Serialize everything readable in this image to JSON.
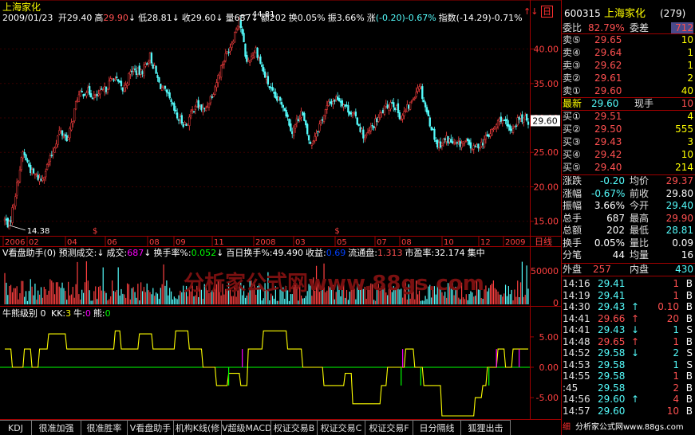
{
  "app": {
    "stock_name": "上海家化",
    "watermark": "分析家公式网www.88gs.com",
    "window_icons": [
      "↑↓",
      "日"
    ]
  },
  "colors": {
    "up": "#ff4040",
    "down": "#54fcfc",
    "yellow": "#ffff00",
    "grid": "#a00000",
    "green": "#00ff00",
    "magenta": "#ff00ff",
    "label": "#ffffff"
  },
  "header": {
    "date": "2009/01/23",
    "items": [
      {
        "label": "开",
        "value": "29.40",
        "color": "#ffffff"
      },
      {
        "label": "高",
        "value": "29.90",
        "color": "#ff5050"
      },
      {
        "label": "低",
        "value": "28.81",
        "color": "#ffffff",
        "arrow": "↓"
      },
      {
        "label": "收",
        "value": "29.60",
        "color": "#ffffff",
        "arrow": "↓"
      },
      {
        "label": "量",
        "value": "687",
        "color": "#ffffff",
        "arrow": "↓"
      },
      {
        "label": "额",
        "value": "202",
        "color": "#ffffff",
        "arrow": "↓"
      },
      {
        "label": "换",
        "value": "0.05%",
        "color": "#ffffff"
      },
      {
        "label": "振",
        "value": "3.66%",
        "color": "#ffffff"
      },
      {
        "label": "涨",
        "value": "(-0.20)-0.67%",
        "color": "#54fcfc"
      },
      {
        "label": "指数",
        "value": "(-14.29)-0.71%",
        "color": "#ffffff"
      }
    ]
  },
  "volume_header": {
    "title": "V看盘助手(0) 预测成交:",
    "items": [
      {
        "label": "成交:",
        "value": "687",
        "color": "#ff00ff",
        "arrow": "↓"
      },
      {
        "label": "换手率%:",
        "value": "0.052",
        "color": "#00ff00",
        "arrow": "↓"
      },
      {
        "label": "百日换手%:",
        "value": "49.490",
        "color": "#ffffff",
        "arrow": "↓"
      },
      {
        "label": "收益:",
        "value": "0.69",
        "color": "#0040ff"
      },
      {
        "label": "流通盘:",
        "value": "1.313",
        "color": "#ff5050"
      },
      {
        "label": "市盈率:",
        "value": "32.174",
        "color": "#ffffff"
      },
      {
        "label": "集中",
        "value": "",
        "color": "#ff0000"
      }
    ]
  },
  "indicator_header": {
    "title": "牛熊级别 0",
    "items": [
      {
        "label": "KK:",
        "value": "3",
        "color": "#ffff00"
      },
      {
        "label": "牛:",
        "value": "0",
        "color": "#ff00ff"
      },
      {
        "label": "熊:",
        "value": "0",
        "color": "#00ff00"
      }
    ]
  },
  "chart_data": {
    "type": "candlestick",
    "price_axis": {
      "ticks": [
        "40.00",
        "35.00",
        "30.00",
        "25.00",
        "20.00",
        "15.00"
      ],
      "range": [
        13.0,
        45.5
      ]
    },
    "current_price_tag": "29.60",
    "annotations": {
      "max": "44.81",
      "min": "14.38"
    },
    "x_labels": [
      "2006",
      "02",
      "04",
      "06",
      "08",
      "09",
      "11",
      "2008",
      "03",
      "05",
      "07",
      "08",
      "10",
      "12",
      "2009"
    ],
    "period_label": "日线",
    "volume_axis": {
      "ticks": [
        "50000",
        "0"
      ]
    },
    "indicator_axis": {
      "ticks": [
        "5.00",
        "0.00",
        "-5.00"
      ],
      "range": [
        -8,
        8
      ]
    },
    "price_anchors": [
      [
        0,
        15.2
      ],
      [
        3,
        14.4
      ],
      [
        7,
        19
      ],
      [
        12,
        25
      ],
      [
        18,
        22
      ],
      [
        24,
        21
      ],
      [
        30,
        24
      ],
      [
        36,
        28
      ],
      [
        42,
        27
      ],
      [
        48,
        33
      ],
      [
        54,
        34
      ],
      [
        60,
        33
      ],
      [
        66,
        34
      ],
      [
        72,
        36
      ],
      [
        78,
        34
      ],
      [
        84,
        37
      ],
      [
        90,
        36.5
      ],
      [
        96,
        39
      ],
      [
        102,
        35
      ],
      [
        108,
        33
      ],
      [
        114,
        30
      ],
      [
        120,
        29
      ],
      [
        126,
        32
      ],
      [
        132,
        31
      ],
      [
        138,
        34
      ],
      [
        144,
        38
      ],
      [
        150,
        41
      ],
      [
        155,
        44.5
      ],
      [
        160,
        38
      ],
      [
        166,
        40
      ],
      [
        172,
        36
      ],
      [
        178,
        33
      ],
      [
        184,
        32
      ],
      [
        190,
        28
      ],
      [
        196,
        31
      ],
      [
        202,
        26
      ],
      [
        208,
        29
      ],
      [
        214,
        32
      ],
      [
        220,
        33
      ],
      [
        226,
        31.5
      ],
      [
        232,
        30
      ],
      [
        238,
        27
      ],
      [
        244,
        29
      ],
      [
        250,
        31
      ],
      [
        256,
        32.5
      ],
      [
        262,
        30
      ],
      [
        268,
        32
      ],
      [
        274,
        35
      ],
      [
        280,
        30
      ],
      [
        286,
        26
      ],
      [
        292,
        27
      ],
      [
        298,
        26
      ],
      [
        304,
        26.5
      ],
      [
        310,
        25.5
      ],
      [
        316,
        26.5
      ],
      [
        322,
        28
      ],
      [
        328,
        30
      ],
      [
        334,
        28
      ],
      [
        340,
        30
      ],
      [
        346,
        29.6
      ]
    ],
    "indicator_kk": [
      [
        0,
        3
      ],
      [
        4,
        3
      ],
      [
        5,
        0
      ],
      [
        12,
        0
      ],
      [
        13,
        3
      ],
      [
        17,
        3
      ],
      [
        18,
        0
      ],
      [
        22,
        0
      ],
      [
        23,
        3
      ],
      [
        28,
        3
      ],
      [
        29,
        5.5
      ],
      [
        40,
        5.5
      ],
      [
        41,
        3
      ],
      [
        72,
        3
      ],
      [
        73,
        6
      ],
      [
        76,
        6
      ],
      [
        77,
        3
      ],
      [
        88,
        3
      ],
      [
        89,
        5.5
      ],
      [
        97,
        5.5
      ],
      [
        98,
        3
      ],
      [
        112,
        3
      ],
      [
        113,
        6
      ],
      [
        121,
        6
      ],
      [
        122,
        3
      ],
      [
        130,
        3
      ],
      [
        131,
        0
      ],
      [
        139,
        0
      ],
      [
        140,
        -3
      ],
      [
        147,
        -3
      ],
      [
        148,
        -1
      ],
      [
        155,
        -1
      ],
      [
        156,
        -3
      ],
      [
        160,
        -3
      ],
      [
        161,
        3
      ],
      [
        170,
        3
      ],
      [
        171,
        6
      ],
      [
        186,
        6
      ],
      [
        187,
        3
      ],
      [
        196,
        3
      ],
      [
        197,
        0
      ],
      [
        210,
        0
      ],
      [
        211,
        -3
      ],
      [
        224,
        -3
      ],
      [
        225,
        -1
      ],
      [
        229,
        -1
      ],
      [
        230,
        -6
      ],
      [
        248,
        -6
      ],
      [
        249,
        -3
      ],
      [
        252,
        -3
      ],
      [
        253,
        0
      ],
      [
        264,
        0
      ],
      [
        265,
        3
      ],
      [
        270,
        3
      ],
      [
        271,
        0
      ],
      [
        276,
        0
      ],
      [
        277,
        -3
      ],
      [
        288,
        -3
      ],
      [
        289,
        -8
      ],
      [
        310,
        -8
      ],
      [
        311,
        -5
      ],
      [
        315,
        -5
      ],
      [
        316,
        -3
      ],
      [
        318,
        -3
      ],
      [
        319,
        0
      ],
      [
        325,
        0
      ],
      [
        326,
        3
      ],
      [
        330,
        3
      ],
      [
        331,
        0
      ],
      [
        335,
        0
      ],
      [
        336,
        3
      ],
      [
        346,
        3
      ]
    ],
    "magenta_spikes": [
      [
        157,
        0,
        3
      ],
      [
        263,
        0,
        3
      ],
      [
        325,
        0,
        3
      ],
      [
        340,
        0,
        3
      ]
    ],
    "green_spikes": [
      [
        148,
        0,
        -3
      ],
      [
        262,
        0,
        -3
      ],
      [
        275,
        0,
        -3
      ],
      [
        320,
        0,
        -3
      ]
    ]
  },
  "sidebar": {
    "code": "600315",
    "name": "上海家化",
    "code_suffix": "(279)",
    "weibi": {
      "label": "委比",
      "value": "82.79%",
      "label2": "委差",
      "value2": "712"
    },
    "sells": [
      {
        "label": "卖⑤",
        "price": "29.65",
        "vol": "10"
      },
      {
        "label": "卖④",
        "price": "29.64",
        "vol": "1"
      },
      {
        "label": "卖③",
        "price": "29.62",
        "vol": "1"
      },
      {
        "label": "卖②",
        "price": "29.61",
        "vol": "2"
      },
      {
        "label": "卖①",
        "price": "29.60",
        "vol": "40"
      }
    ],
    "latest": {
      "label": "最新",
      "value": "29.60",
      "label2": "现手",
      "value2": "10"
    },
    "buys": [
      {
        "label": "买①",
        "price": "29.51",
        "vol": "4"
      },
      {
        "label": "买②",
        "price": "29.50",
        "vol": "555"
      },
      {
        "label": "买③",
        "price": "29.43",
        "vol": "3"
      },
      {
        "label": "买④",
        "price": "29.42",
        "vol": "10"
      },
      {
        "label": "买⑤",
        "price": "29.40",
        "vol": "214"
      }
    ],
    "stats": [
      {
        "l1": "涨跌",
        "v1": "-0.20",
        "c1": "#54fcfc",
        "l2": "均价",
        "v2": "29.37",
        "c2": "#ff5050"
      },
      {
        "l1": "涨幅",
        "v1": "-0.67%",
        "c1": "#54fcfc",
        "l2": "前收",
        "v2": "29.80",
        "c2": "#ffffff"
      },
      {
        "l1": "振幅",
        "v1": "3.66%",
        "c1": "#ffffff",
        "l2": "今开",
        "v2": "29.40",
        "c2": "#54fcfc"
      },
      {
        "l1": "总手",
        "v1": "687",
        "c1": "#ffffff",
        "l2": "最高",
        "v2": "29.90",
        "c2": "#ff5050"
      },
      {
        "l1": "总额",
        "v1": "202",
        "c1": "#ffffff",
        "l2": "最低",
        "v2": "28.81",
        "c2": "#54fcfc"
      },
      {
        "l1": "换手",
        "v1": "0.05%",
        "c1": "#ffffff",
        "l2": "量比",
        "v2": "0.09",
        "c2": "#ffffff"
      },
      {
        "l1": "分笔",
        "v1": "44",
        "c1": "#ffffff",
        "l2": "均量",
        "v2": "16",
        "c2": "#ffffff"
      }
    ],
    "outer": {
      "label": "外盘",
      "value": "257",
      "label2": "内盘",
      "value2": "430"
    },
    "ticks": [
      {
        "time": "14:16",
        "price": "29.41",
        "arrow": "",
        "vol": "1",
        "side": "B",
        "pc": "#54fcfc",
        "vc": "#ff5050"
      },
      {
        "time": "14:19",
        "price": "29.41",
        "arrow": "",
        "vol": "1",
        "side": "B",
        "pc": "#54fcfc",
        "vc": "#ff5050"
      },
      {
        "time": "14:30",
        "price": "29.43",
        "arrow": "↑",
        "vol": "0.10",
        "side": "B",
        "pc": "#54fcfc",
        "vc": "#ff5050"
      },
      {
        "time": "14:41",
        "price": "29.66",
        "arrow": "↑",
        "vol": "20",
        "side": "B",
        "pc": "#ff5050",
        "vc": "#ff5050"
      },
      {
        "time": "14:41",
        "price": "29.43",
        "arrow": "↓",
        "vol": "1",
        "side": "S",
        "pc": "#54fcfc",
        "vc": "#54fcfc"
      },
      {
        "time": "14:48",
        "price": "29.65",
        "arrow": "↑",
        "vol": "1",
        "side": "B",
        "pc": "#ff5050",
        "vc": "#ff5050"
      },
      {
        "time": "14:52",
        "price": "29.58",
        "arrow": "↓",
        "vol": "2",
        "side": "S",
        "pc": "#54fcfc",
        "vc": "#54fcfc"
      },
      {
        "time": "14:53",
        "price": "29.58",
        "arrow": "",
        "vol": "1",
        "side": "S",
        "pc": "#54fcfc",
        "vc": "#54fcfc"
      },
      {
        "time": "14:55",
        "price": "29.58",
        "arrow": "",
        "vol": "1",
        "side": "B",
        "pc": "#54fcfc",
        "vc": "#ff5050"
      },
      {
        "time": ":45",
        "price": "29.58",
        "arrow": "",
        "vol": "2",
        "side": "B",
        "pc": "#54fcfc",
        "vc": "#ff5050"
      },
      {
        "time": "14:56",
        "price": "29.60",
        "arrow": "↑",
        "vol": "4",
        "side": "B",
        "pc": "#54fcfc",
        "vc": "#ff5050"
      },
      {
        "time": "14:57",
        "price": "29.60",
        "arrow": "",
        "vol": "10",
        "side": "B",
        "pc": "#54fcfc",
        "vc": "#ff5050"
      }
    ],
    "bottom_label": "细",
    "bottom_watermark": "分析家公式网www.88gs.com"
  },
  "tabs": [
    "KDJ",
    "很准加强",
    "很准胜率",
    "V看盘助手",
    "机构K线(修",
    "V超级MACD",
    "权证交易B",
    "权证交易C",
    "权证交易F",
    "日分隔线",
    "狐狸出击"
  ]
}
